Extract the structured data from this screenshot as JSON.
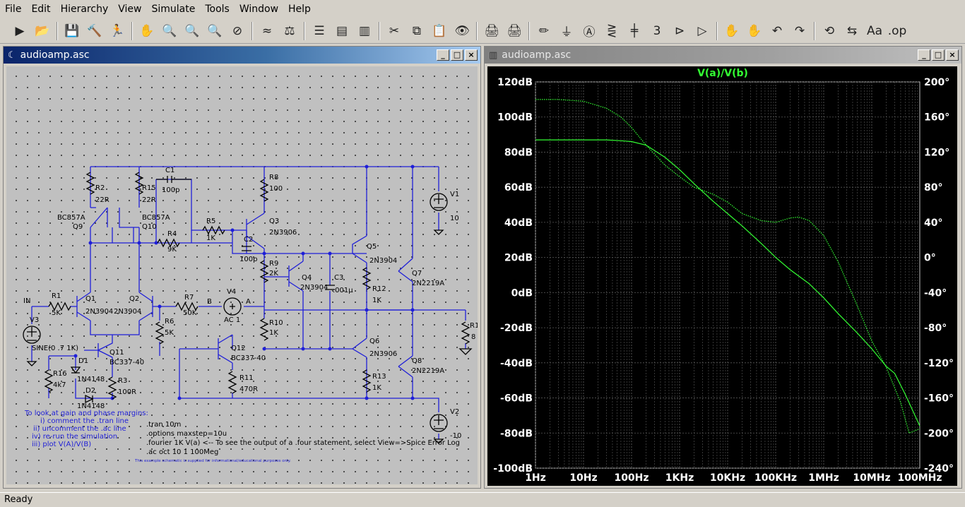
{
  "menu": [
    "File",
    "Edit",
    "Hierarchy",
    "View",
    "Simulate",
    "Tools",
    "Window",
    "Help"
  ],
  "toolbar_icons": [
    "run-icon",
    "open-icon",
    "save-icon",
    "control-panel-icon",
    "halt-icon",
    "pan-icon",
    "zoom-in-icon",
    "zoom-area-icon",
    "zoom-out-icon",
    "zoom-cancel-icon",
    "autorange-icon",
    "measure-icon",
    "tile-horizontal-icon",
    "cascade-icon",
    "tile-vertical-icon",
    "cut-icon",
    "copy-icon",
    "paste-icon",
    "find-icon",
    "print-preview-icon",
    "print-icon",
    "draw-wire-icon",
    "ground-icon",
    "label-net-icon",
    "resistor-icon",
    "capacitor-icon",
    "inductor-icon",
    "diode-icon",
    "component-icon",
    "move-icon",
    "drag-icon",
    "undo-icon",
    "redo-icon",
    "rotate-icon",
    "mirror-icon",
    "text-icon",
    "spice-directive-icon"
  ],
  "toolbar_glyphs": [
    "▶",
    "📂",
    "💾",
    "🔨",
    "🏃",
    "✋",
    "🔍",
    "🔍",
    "🔍",
    "⊘",
    "≈",
    "⚖",
    "☰",
    "▤",
    "▥",
    "✂",
    "⧉",
    "📋",
    "👁",
    "🖨",
    "🖨",
    "✏",
    "⏚",
    "Ⓐ",
    "⋛",
    "╪",
    "3",
    "⊳",
    "▷",
    "✋",
    "✋",
    "↶",
    "↷",
    "⟲",
    "⇆",
    "Aa",
    ".op"
  ],
  "schematic_window": {
    "title": "audioamp.asc",
    "labels": {
      "IN": "IN",
      "R1": "R1",
      "R1v": "5K",
      "V3": "V3",
      "V3v": "SINE(0 .7 1K)",
      "Q1": "Q1",
      "Q1m": "2N3904",
      "Q2": "Q2",
      "Q2m": "2N3904",
      "R2": "R2",
      "R2v": "22R",
      "R15": "R15",
      "R15v": "22R",
      "C1": "C1",
      "C1v": "100p",
      "Q9": "Q9",
      "Q9m": "BC857A",
      "Q10": "Q10",
      "Q10m": "BC857A",
      "R4": "R4",
      "R4v": "9K",
      "R5": "R5",
      "R5v": "1K",
      "R7": "R7",
      "R7v": "50K",
      "B": "B",
      "A": "A",
      "V4": "V4",
      "V4v": "AC 1",
      "R6": "R6",
      "R6v": "5K",
      "R8": "R8",
      "R8v": "100",
      "Q3": "Q3",
      "Q3m": "2N3906",
      "C2": "C2",
      "C2v": "100p",
      "R9": "R9",
      "R9v": "2K",
      "Q4": "Q4",
      "Q4m": "2N3904",
      "C3": "C3",
      "C3v": ".001µ",
      "R10": "R10",
      "R10v": "1K",
      "Q5": "Q5",
      "Q5m": "2N3904",
      "R12": "R12",
      "R12v": "1K",
      "Q6": "Q6",
      "Q6m": "2N3906",
      "R13": "R13",
      "R13v": "1K",
      "Q7": "Q7",
      "Q7m": "2N2219A",
      "Q8": "Q8",
      "Q8m": "2N2219A",
      "V1": "V1",
      "V1v": "10",
      "V2": "V2",
      "V2v": "-10",
      "RL": "R1",
      "RLv": "8",
      "Q11": "Q11",
      "Q11m": "BC337-40",
      "Q12": "Q12",
      "Q12m": "BC337-40",
      "R16": "R16",
      "R16v": "4k7",
      "D1": "D1",
      "D1m": "1N4148",
      "D2": "D2",
      "D2m": "1N4148",
      "R3": "R3",
      "R3v": "100R",
      "R11": "R11",
      "R11v": "470R"
    },
    "comment_lines": [
      "To look at gain and phase margins:",
      "i) comment the .tran line",
      "ii) uncomment the .ac line",
      "iv) re-run the simulation",
      "iii) plot V(A)/V(B)"
    ],
    "directives": [
      ".tran 10m",
      ".options maxstep=10u",
      ".fourier 1K V(a)  <-- To see the output of a .four statement, select View=>Spice Error Log",
      ".ac oct 10 1 100Meg"
    ],
    "footnote": "This example schematic is supplied for informational/educational purposes only."
  },
  "plot_window": {
    "title": "audioamp.asc",
    "trace_name": "V(a)/V(b)"
  },
  "chart_data": {
    "type": "line",
    "title": "V(a)/V(b)",
    "x_scale": "log",
    "xlim": [
      1,
      100000000
    ],
    "x_ticks": [
      1,
      10,
      100,
      1000,
      10000,
      100000,
      1000000,
      10000000,
      100000000
    ],
    "x_tick_labels": [
      "1Hz",
      "10Hz",
      "100Hz",
      "1KHz",
      "10KHz",
      "100KHz",
      "1MHz",
      "10MHz",
      "100MHz"
    ],
    "y_left_lim": [
      -100,
      120
    ],
    "y_left_ticks": [
      -100,
      -80,
      -60,
      -40,
      -20,
      0,
      20,
      40,
      60,
      80,
      100,
      120
    ],
    "y_left_tick_labels": [
      "-100dB",
      "-80dB",
      "-60dB",
      "-40dB",
      "-20dB",
      "0dB",
      "20dB",
      "40dB",
      "60dB",
      "80dB",
      "100dB",
      "120dB"
    ],
    "y_right_lim": [
      -240,
      200
    ],
    "y_right_ticks": [
      -240,
      -200,
      -160,
      -120,
      -80,
      -40,
      0,
      40,
      80,
      120,
      160,
      200
    ],
    "y_right_tick_labels": [
      "-240°",
      "-200°",
      "-160°",
      "-120°",
      "-80°",
      "-40°",
      "0°",
      "40°",
      "80°",
      "120°",
      "160°",
      "200°"
    ],
    "grid": true,
    "colors": {
      "background": "#000000",
      "grid": "#5a5a5a",
      "axis_text": "#ffffff",
      "trace": "#33ff33",
      "title": "#33ff33"
    },
    "series": [
      {
        "axis": "left",
        "style": "solid",
        "x": [
          1,
          10,
          30,
          60,
          100,
          200,
          500,
          1000,
          2000,
          5000,
          10000,
          20000,
          50000,
          100000,
          200000,
          500000,
          1000000,
          2000000,
          5000000,
          10000000,
          20000000,
          30000000,
          50000000,
          100000000
        ],
        "y": [
          87,
          87,
          87,
          86.5,
          86,
          84,
          77,
          70,
          62,
          52,
          45,
          38,
          28,
          20,
          13,
          5,
          -3,
          -12,
          -23,
          -32,
          -42,
          -46,
          -58,
          -76
        ]
      },
      {
        "axis": "right",
        "style": "dotted",
        "x": [
          1,
          3,
          10,
          30,
          60,
          100,
          200,
          500,
          1000,
          2000,
          5000,
          10000,
          20000,
          50000,
          100000,
          200000,
          300000,
          500000,
          1000000,
          2000000,
          5000000,
          10000000,
          20000000,
          40000000,
          60000000,
          100000000
        ],
        "y": [
          180,
          180,
          178,
          170,
          160,
          148,
          128,
          105,
          92,
          80,
          72,
          63,
          50,
          42,
          40,
          45,
          46,
          42,
          25,
          -5,
          -55,
          -95,
          -125,
          -165,
          -200,
          -195
        ]
      }
    ]
  },
  "status": {
    "text": "Ready"
  }
}
